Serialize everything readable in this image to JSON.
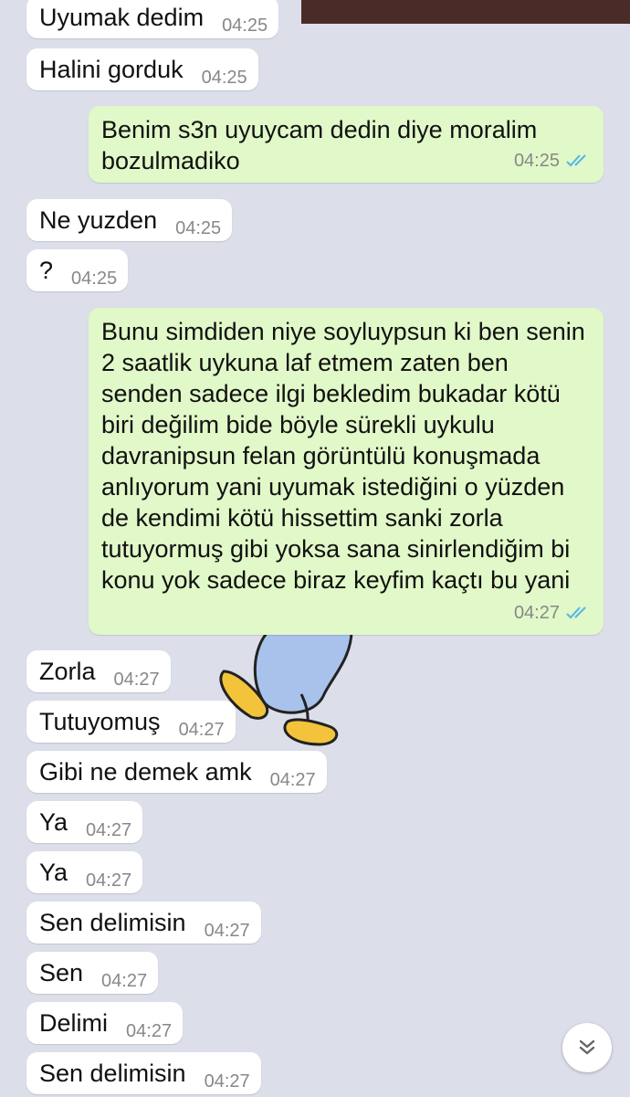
{
  "messages": [
    {
      "dir": "in",
      "text": "Uyumak dedim",
      "time": "04:25"
    },
    {
      "dir": "in",
      "text": "Halini gorduk",
      "time": "04:25"
    },
    {
      "dir": "out",
      "text": "Benim s3n uyuycam dedin diye moralim bozulmadiko",
      "time": "04:25",
      "status": "read"
    },
    {
      "dir": "in",
      "text": "Ne yuzden",
      "time": "04:25"
    },
    {
      "dir": "in",
      "text": "?",
      "time": "04:25"
    },
    {
      "dir": "out",
      "text": "Bunu simdiden niye soyluypsun ki ben senin 2 saatlik uykuna laf etmem zaten ben senden sadece ilgi bekledim bukadar kötü biri değilim bide böyle sürekli uykulu davranipsun felan görüntülü konuşmada anlıyorum yani uyumak istediğini o yüzden de kendimi kötü hissettim sanki zorla tutuyormuş gibi yoksa sana sinirlendiğim bi konu yok sadece biraz keyfim kaçtı bu yani",
      "time": "04:27",
      "status": "read"
    },
    {
      "dir": "in",
      "text": "Zorla",
      "time": "04:27"
    },
    {
      "dir": "in",
      "text": "Tutuyomuş",
      "time": "04:27"
    },
    {
      "dir": "in",
      "text": "Gibi ne demek amk",
      "time": "04:27"
    },
    {
      "dir": "in",
      "text": "Ya",
      "time": "04:27"
    },
    {
      "dir": "in",
      "text": "Ya",
      "time": "04:27"
    },
    {
      "dir": "in",
      "text": "Sen delimisin",
      "time": "04:27"
    },
    {
      "dir": "in",
      "text": "Sen",
      "time": "04:27"
    },
    {
      "dir": "in",
      "text": "Delimi",
      "time": "04:27"
    },
    {
      "dir": "in",
      "text": "Sen delimisin",
      "time": "04:27"
    }
  ],
  "colors": {
    "background": "#dcdee9",
    "incoming_bubble": "#ffffff",
    "outgoing_bubble": "#e1f8c8",
    "read_ticks": "#4fb6ec",
    "header": "#4a2b27"
  },
  "icons": {
    "read_receipt": "double-check-icon",
    "scroll_down": "double-chevron-down-icon",
    "sticker": "cartoon-legs-sticker"
  }
}
